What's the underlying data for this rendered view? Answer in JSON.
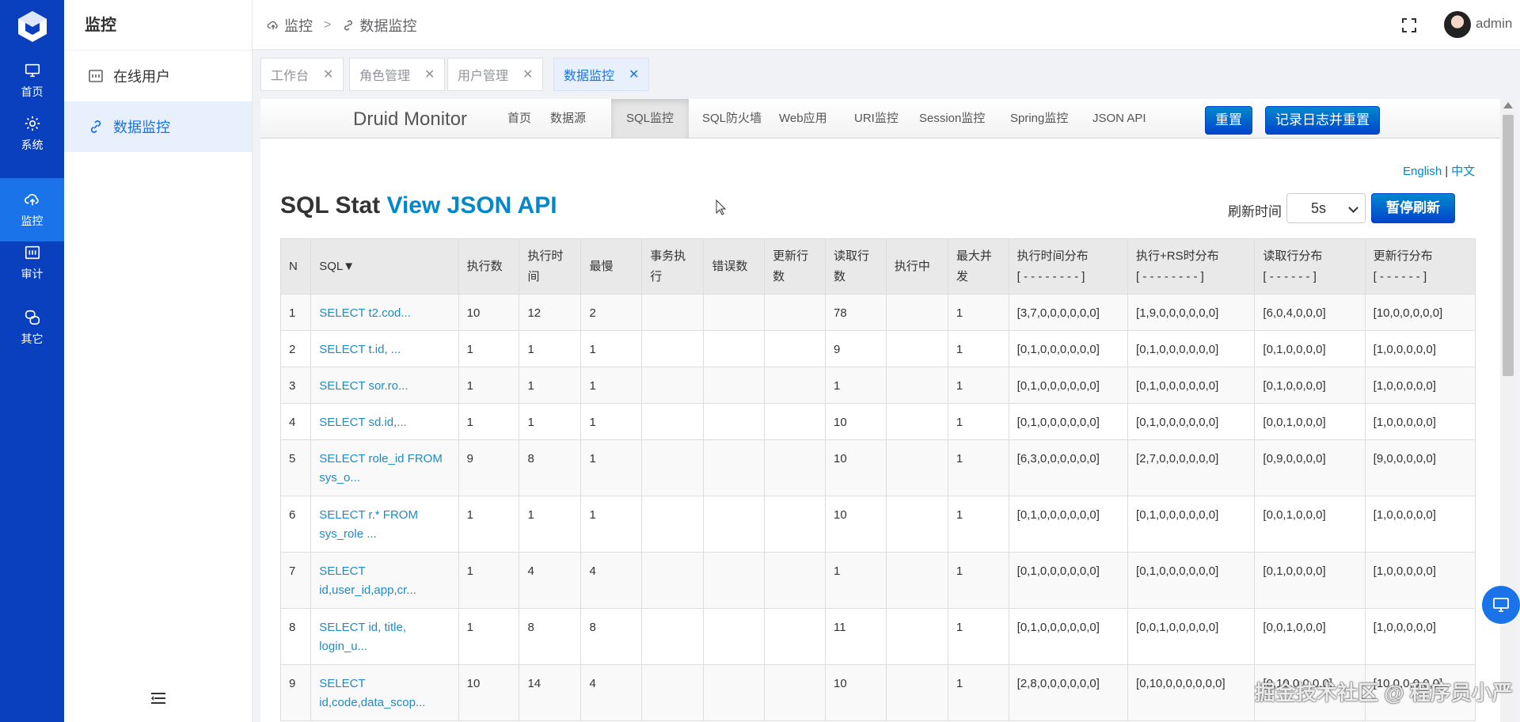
{
  "rail": {
    "items": [
      {
        "label": "首页",
        "icon": "monitor-icon"
      },
      {
        "label": "系统",
        "icon": "gear-icon"
      },
      {
        "label": "监控",
        "icon": "cloud-icon",
        "active": true
      },
      {
        "label": "审计",
        "icon": "audit-icon"
      },
      {
        "label": "其它",
        "icon": "chat-icon"
      }
    ]
  },
  "sidebar": {
    "title": "监控",
    "items": [
      {
        "label": "在线用户",
        "icon": "terminal-icon"
      },
      {
        "label": "数据监控",
        "icon": "link-icon",
        "active": true
      }
    ]
  },
  "header": {
    "breadcrumb": [
      "监控",
      "数据监控"
    ],
    "username": "admin"
  },
  "tabs": [
    {
      "label": "工作台"
    },
    {
      "label": "角色管理"
    },
    {
      "label": "用户管理"
    },
    {
      "label": "数据监控",
      "active": true
    }
  ],
  "druid": {
    "brand": "Druid Monitor",
    "nav": [
      "首页",
      "数据源",
      "SQL监控",
      "SQL防火墙",
      "Web应用",
      "URI监控",
      "Session监控",
      "Spring监控",
      "JSON API"
    ],
    "active_nav": "SQL监控",
    "reset_btn": "重置",
    "log_reset_btn": "记录日志并重置",
    "lang_en": "English",
    "lang_sep": "|",
    "lang_zh": "中文",
    "heading": "SQL Stat",
    "heading_link": "View JSON API",
    "refresh_label": "刷新时间",
    "refresh_value": "5s",
    "pause_btn": "暂停刷新"
  },
  "table": {
    "headers": [
      "N",
      "SQL▼",
      "执行数",
      "执行时\n间",
      "最慢",
      "事务执\n行",
      "错误数",
      "更新行\n数",
      "读取行\n数",
      "执行中",
      "最大并\n发",
      "执行时间分布\n[ - - - - - - - - ]",
      "执行+RS时分布\n[ - - - - - - - - ]",
      "读取行分布\n[ - - - - - - ]",
      "更新行分布\n[ - - - - - - ]"
    ],
    "rows": [
      [
        "1",
        "SELECT t2.cod...",
        "10",
        "12",
        "2",
        "",
        "",
        "",
        "78",
        "",
        "1",
        "[3,7,0,0,0,0,0,0]",
        "[1,9,0,0,0,0,0,0]",
        "[6,0,4,0,0,0]",
        "[10,0,0,0,0,0]"
      ],
      [
        "2",
        "SELECT t.id, ...",
        "1",
        "1",
        "1",
        "",
        "",
        "",
        "9",
        "",
        "1",
        "[0,1,0,0,0,0,0,0]",
        "[0,1,0,0,0,0,0,0]",
        "[0,1,0,0,0,0]",
        "[1,0,0,0,0,0]"
      ],
      [
        "3",
        "SELECT sor.ro...",
        "1",
        "1",
        "1",
        "",
        "",
        "",
        "1",
        "",
        "1",
        "[0,1,0,0,0,0,0,0]",
        "[0,1,0,0,0,0,0,0]",
        "[0,1,0,0,0,0]",
        "[1,0,0,0,0,0]"
      ],
      [
        "4",
        "SELECT sd.id,...",
        "1",
        "1",
        "1",
        "",
        "",
        "",
        "10",
        "",
        "1",
        "[0,1,0,0,0,0,0,0]",
        "[0,1,0,0,0,0,0,0]",
        "[0,0,1,0,0,0]",
        "[1,0,0,0,0,0]"
      ],
      [
        "5",
        "SELECT role_id FROM sys_o...",
        "9",
        "8",
        "1",
        "",
        "",
        "",
        "10",
        "",
        "1",
        "[6,3,0,0,0,0,0,0]",
        "[2,7,0,0,0,0,0,0]",
        "[0,9,0,0,0,0]",
        "[9,0,0,0,0,0]"
      ],
      [
        "6",
        "SELECT r.* FROM sys_role ...",
        "1",
        "1",
        "1",
        "",
        "",
        "",
        "10",
        "",
        "1",
        "[0,1,0,0,0,0,0,0]",
        "[0,1,0,0,0,0,0,0]",
        "[0,0,1,0,0,0]",
        "[1,0,0,0,0,0]"
      ],
      [
        "7",
        "SELECT id,user_id,app,cr...",
        "1",
        "4",
        "4",
        "",
        "",
        "",
        "1",
        "",
        "1",
        "[0,1,0,0,0,0,0,0]",
        "[0,1,0,0,0,0,0,0]",
        "[0,1,0,0,0,0]",
        "[1,0,0,0,0,0]"
      ],
      [
        "8",
        "SELECT id, title, login_u...",
        "1",
        "8",
        "8",
        "",
        "",
        "",
        "11",
        "",
        "1",
        "[0,1,0,0,0,0,0,0]",
        "[0,0,1,0,0,0,0,0]",
        "[0,0,1,0,0,0]",
        "[1,0,0,0,0,0]"
      ],
      [
        "9",
        "SELECT id,code,data_scop...",
        "10",
        "14",
        "4",
        "",
        "",
        "",
        "10",
        "",
        "1",
        "[2,8,0,0,0,0,0,0]",
        "[0,10,0,0,0,0,0,0]",
        "[0,10,0,0,0,0]",
        "[10,0,0,0,0,0]"
      ]
    ]
  },
  "watermark": "掘金技术社区 @ 程序员小严",
  "colors": {
    "rail": "#0a3fbd",
    "accent": "#1a73e8",
    "druid_blue": "#0088cc"
  }
}
